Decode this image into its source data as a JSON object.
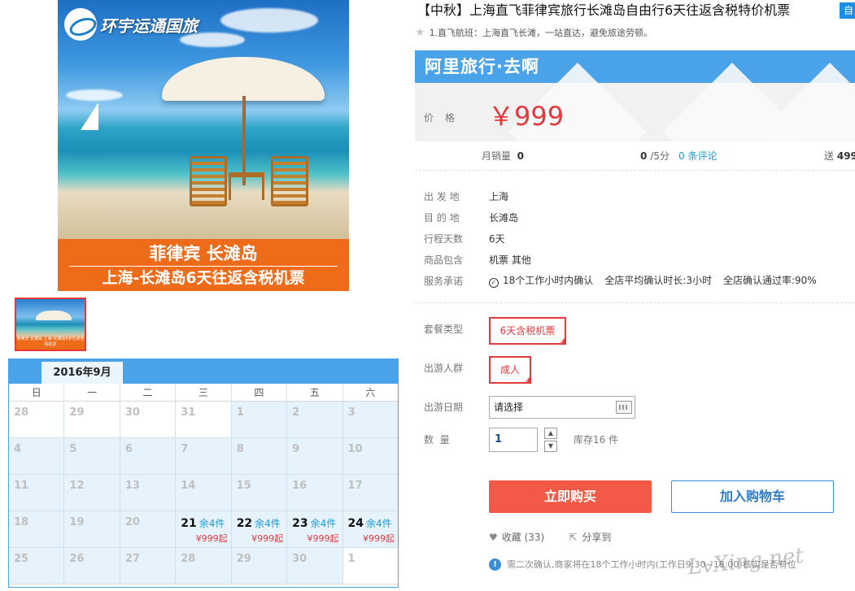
{
  "main_image": {
    "logo_text": "环宇运通国旅",
    "banner_title": "菲律宾 长滩岛",
    "banner_subtitle": "上海-长滩岛6天往返含税机票"
  },
  "thumbnail": {
    "caption": "菲律宾 长滩岛\n上海-长滩岛6天往返含税机票"
  },
  "calendar": {
    "month": "2016年9月",
    "weekdays": [
      "日",
      "一",
      "二",
      "三",
      "四",
      "五",
      "六"
    ],
    "weeks": [
      [
        {
          "d": "28",
          "other": true
        },
        {
          "d": "29",
          "other": true
        },
        {
          "d": "30",
          "other": true
        },
        {
          "d": "31",
          "other": true
        },
        {
          "d": "1"
        },
        {
          "d": "2"
        },
        {
          "d": "3"
        }
      ],
      [
        {
          "d": "4"
        },
        {
          "d": "5"
        },
        {
          "d": "6"
        },
        {
          "d": "7"
        },
        {
          "d": "8"
        },
        {
          "d": "9"
        },
        {
          "d": "10"
        }
      ],
      [
        {
          "d": "11"
        },
        {
          "d": "12"
        },
        {
          "d": "13"
        },
        {
          "d": "14"
        },
        {
          "d": "15"
        },
        {
          "d": "16"
        },
        {
          "d": "17"
        }
      ],
      [
        {
          "d": "18"
        },
        {
          "d": "19"
        },
        {
          "d": "20"
        },
        {
          "d": "21",
          "stock": "余4件",
          "price": "¥999起"
        },
        {
          "d": "22",
          "stock": "余4件",
          "price": "¥999起"
        },
        {
          "d": "23",
          "stock": "余4件",
          "price": "¥999起"
        },
        {
          "d": "24",
          "stock": "余4件",
          "price": "¥999起"
        }
      ],
      [
        {
          "d": "25"
        },
        {
          "d": "26"
        },
        {
          "d": "27"
        },
        {
          "d": "28"
        },
        {
          "d": "29"
        },
        {
          "d": "30"
        },
        {
          "d": "1",
          "other": true
        }
      ]
    ]
  },
  "product": {
    "title": "【中秋】上海直飞菲律宾旅行长滩岛自由行6天往返含税特价机票",
    "title_tag": "自",
    "subtitle": "1.直飞航班：上海直飞长滩，一站直达，避免旅途劳顿。"
  },
  "price_panel": {
    "brand": "阿里旅行·去啊",
    "price_label": "价格",
    "price": "￥999"
  },
  "stats": {
    "monthly_sales_label": "月销量",
    "monthly_sales": "0",
    "rating": "0",
    "rating_suffix": "/5分",
    "reviews": "0 条评论",
    "points_label": "送",
    "points": "499"
  },
  "info": {
    "departure_label": "出 发 地",
    "departure": "上海",
    "destination_label": "目 的 地",
    "destination": "长滩岛",
    "days_label": "行程天数",
    "days": "6天",
    "includes_label": "商品包含",
    "includes": "机票  其他",
    "promise_label": "服务承诺",
    "promises": [
      "18个工作小时内确认",
      "全店平均确认时长:3小时",
      "全店确认通过率:90%"
    ]
  },
  "options": {
    "package_label": "套餐类型",
    "package_value": "6天含税机票",
    "traveler_label": "出游人群",
    "traveler_value": "成人",
    "date_label": "出游日期",
    "date_placeholder": "请选择",
    "qty_label": "数  量",
    "qty_value": "1",
    "stock_note": "库存16 件"
  },
  "buttons": {
    "buy": "立即购买",
    "cart": "加入购物车"
  },
  "actions": {
    "favorite": "收藏",
    "favorite_count": "(33)",
    "share": "分享到"
  },
  "notice": "需二次确认,商家将在18个工作小时内(工作日9:30~18:00)核实是否有位",
  "watermark": "LvXing.net",
  "colors": {
    "accent_red": "#e4393c",
    "brand_blue": "#4aa3e8",
    "buy_button": "#f25a47"
  }
}
